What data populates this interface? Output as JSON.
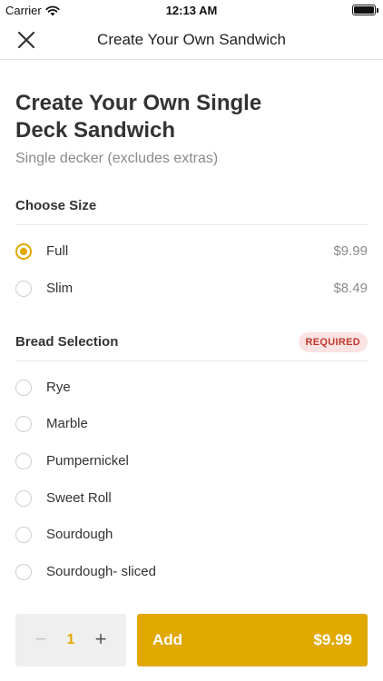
{
  "status_bar": {
    "carrier": "Carrier",
    "time": "12:13 AM",
    "icons": [
      "wifi-icon",
      "battery-icon"
    ]
  },
  "nav": {
    "title": "Create Your Own Sandwich",
    "close_icon": "close-icon"
  },
  "product": {
    "title": "Create Your Own Single Deck Sandwich",
    "subtitle": "Single decker (excludes extras)"
  },
  "size_section": {
    "title": "Choose Size",
    "options": [
      {
        "label": "Full",
        "price": "$9.99",
        "selected": true
      },
      {
        "label": "Slim",
        "price": "$8.49",
        "selected": false
      }
    ]
  },
  "bread_section": {
    "title": "Bread Selection",
    "badge": "REQUIRED",
    "options": [
      {
        "label": "Rye"
      },
      {
        "label": "Marble"
      },
      {
        "label": "Pumpernickel"
      },
      {
        "label": "Sweet Roll"
      },
      {
        "label": "Sourdough"
      },
      {
        "label": "Sourdough- sliced"
      }
    ]
  },
  "bottom_bar": {
    "minus": "−",
    "quantity": "1",
    "plus": "+",
    "add_label": "Add",
    "add_price": "$9.99"
  },
  "colors": {
    "accent": "#e0a800",
    "badge_bg": "#fbe3e3",
    "badge_text": "#c0392b",
    "muted_text": "#8a8a8a"
  }
}
